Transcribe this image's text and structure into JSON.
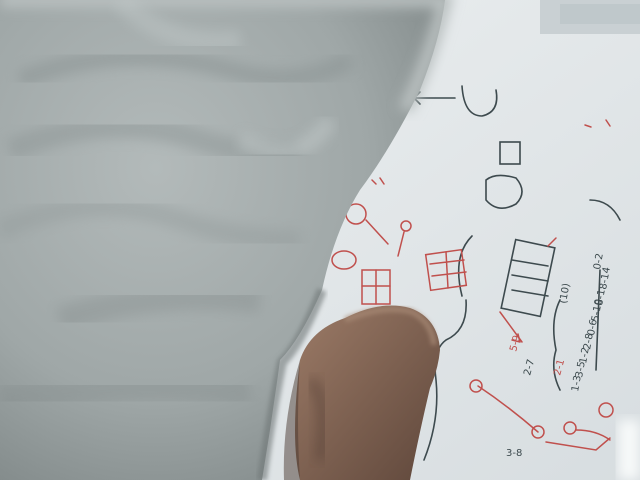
{
  "scene": {
    "subject": "photo",
    "colors": {
      "whiteboard": "#e6eaec",
      "whiteboard_shadow": "#cdd3d6",
      "shirt": "#a9b0b0",
      "shirt_dark": "#7f8787",
      "skin": "#8a6d5c",
      "skin_shadow": "#5e463a",
      "marker_red": "#c0504d",
      "marker_dark": "#3d4a4e"
    }
  },
  "board_notes": {
    "list_1": "0-2",
    "list_2": "8-14",
    "list_3": "8-1",
    "list_4": "5-10",
    "list_5": "0-6",
    "list_6": "2-8",
    "list_7": "1-2",
    "list_8": "3-5",
    "list_9": "1-3",
    "mid_1": "(10)",
    "mid_2": "5-9",
    "mid_3": "2-7",
    "bottom_1": "3-8",
    "bottom_2": "2-1"
  }
}
